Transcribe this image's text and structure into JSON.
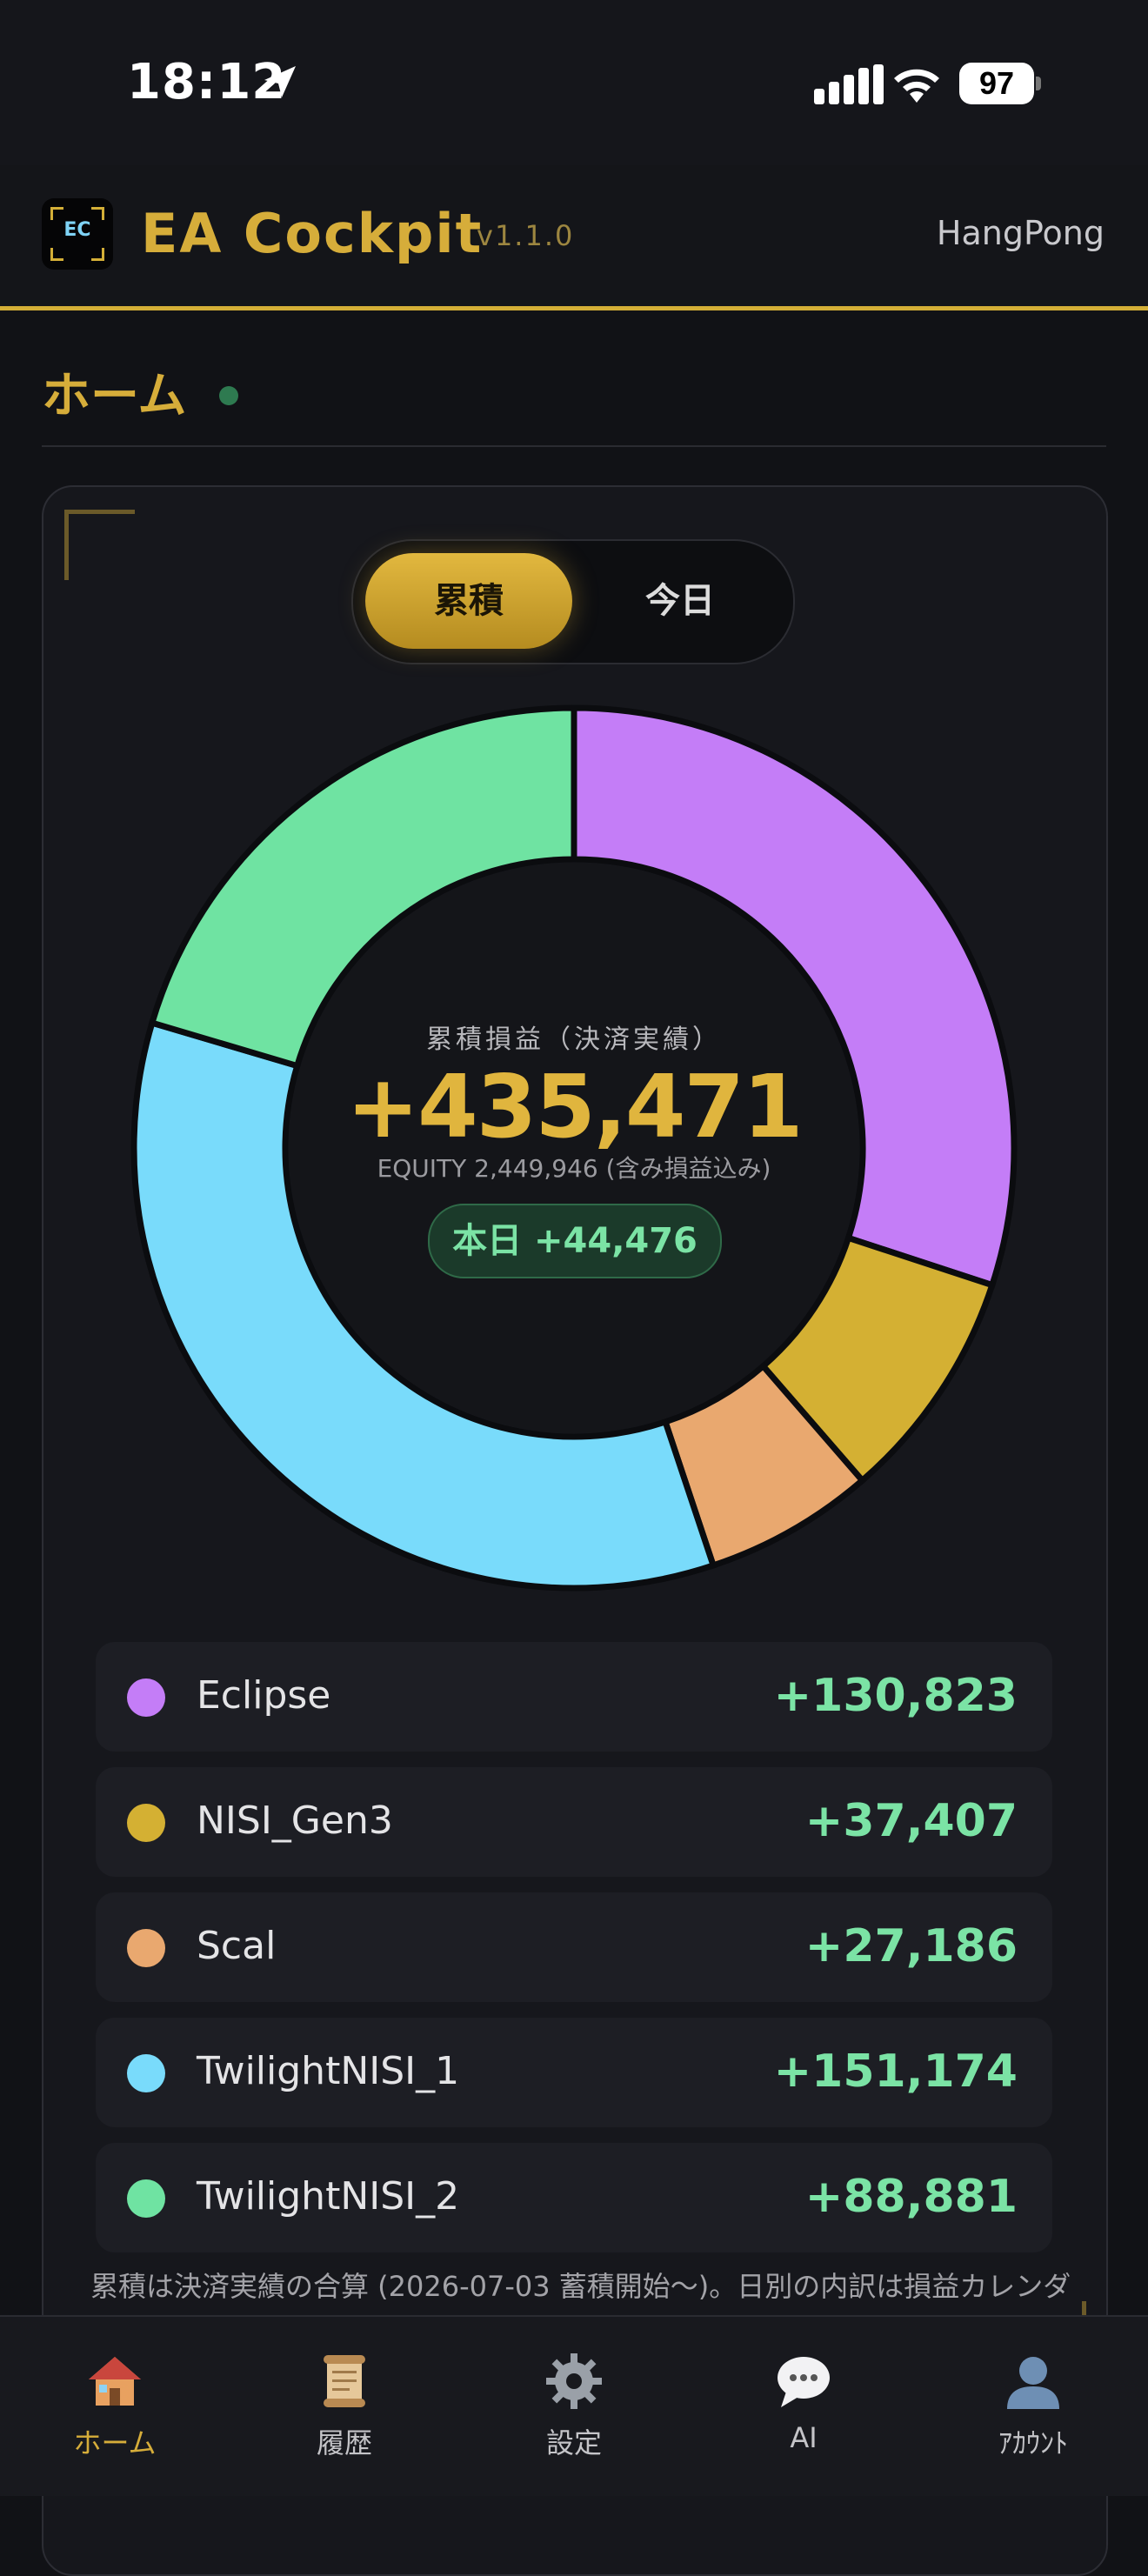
{
  "status_bar": {
    "time": "18:12",
    "battery": "97"
  },
  "header": {
    "logo_text": "EC",
    "title": "EA Cockpit",
    "version": "v1.1.0",
    "user": "HangPong"
  },
  "page": {
    "title": "ホーム"
  },
  "toggle": {
    "active": "累積",
    "inactive": "今日"
  },
  "summary": {
    "label": "累積損益（決済実績）",
    "value": "+435,471",
    "equity": "EQUITY 2,449,946 (含み損益込み)",
    "today": "本日 +44,476"
  },
  "colors": {
    "accent": "#d6ad3a",
    "positive": "#7be3a5"
  },
  "chart_data": {
    "type": "pie",
    "categories": [
      "Eclipse",
      "NISI_Gen3",
      "Scal",
      "TwilightNISI_1",
      "TwilightNISI_2"
    ],
    "values": [
      130823,
      37407,
      27186,
      151174,
      88881
    ],
    "colors": [
      "#c47df7",
      "#d4b033",
      "#e9a86f",
      "#79dbfb",
      "#6fe3a2"
    ]
  },
  "legend": [
    {
      "name": "Eclipse",
      "value": "+130,823",
      "color": "#c47df7"
    },
    {
      "name": "NISI_Gen3",
      "value": "+37,407",
      "color": "#d4b033"
    },
    {
      "name": "Scal",
      "value": "+27,186",
      "color": "#e9a86f"
    },
    {
      "name": "TwilightNISI_1",
      "value": "+151,174",
      "color": "#79dbfb"
    },
    {
      "name": "TwilightNISI_2",
      "value": "+88,881",
      "color": "#6fe3a2"
    }
  ],
  "footnote": "累積は決済実績の合算 (2026-07-03 蓄積開始〜)。日別の内訳は損益カレンダ",
  "nav": [
    {
      "label": "ホーム",
      "icon": "house-icon"
    },
    {
      "label": "履歴",
      "icon": "scroll-icon"
    },
    {
      "label": "設定",
      "icon": "gear-icon"
    },
    {
      "label": "AI",
      "icon": "speech-bubble-icon"
    },
    {
      "label": "ｱｶｳﾝﾄ",
      "icon": "person-icon"
    }
  ]
}
